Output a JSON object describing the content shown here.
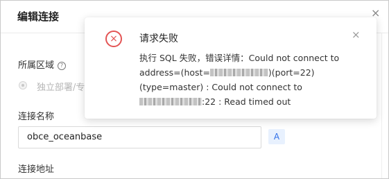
{
  "drawer": {
    "title": "编辑连接",
    "close_glyph": "×",
    "region_label": "所属区域",
    "help_glyph": "?",
    "region_option": "独立部署/专",
    "conn_name_label": "连接名称",
    "conn_name_value": "obce_oceanbase",
    "tag_label": "A",
    "conn_addr_label": "连接地址"
  },
  "notification": {
    "icon": "close-circle-icon",
    "icon_glyph": "×",
    "title": "请求失败",
    "close_glyph": "×",
    "line1": "执行 SQL 失败，错误详情：Could not connect to",
    "line2_prefix": "address=(host=",
    "line2_suffix": ")(port=22)",
    "line3": "(type=master) : Could not connect to",
    "line4_suffix": ":22 : Read timed out"
  },
  "colors": {
    "error": "#e35454",
    "accent": "#2f6fe8"
  }
}
